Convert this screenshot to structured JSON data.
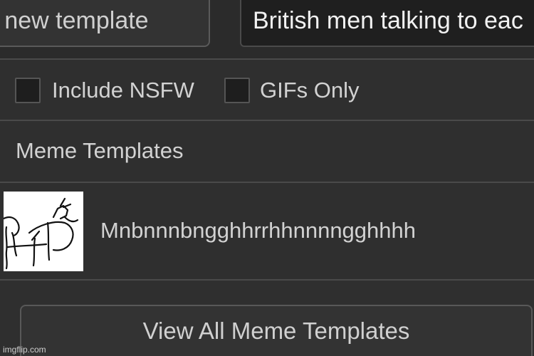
{
  "header": {
    "add_template_label": "d new template",
    "search_value": "British men talking to eac"
  },
  "filters": {
    "include_nsfw_label": "Include NSFW",
    "include_nsfw_checked": false,
    "gifs_only_label": "GIFs Only",
    "gifs_only_checked": false
  },
  "section": {
    "title": "Meme Templates"
  },
  "templates": [
    {
      "name": "Mnbnnnbngghhrrhhnnnngghhhh"
    }
  ],
  "footer": {
    "view_all_label": "View All Meme Templates"
  },
  "watermark": "imgflip.com",
  "colors": {
    "background": "#2f2f2f",
    "input_background": "#1f1f1f",
    "text": "#d2d2d2",
    "border": "#4a4a4a"
  }
}
